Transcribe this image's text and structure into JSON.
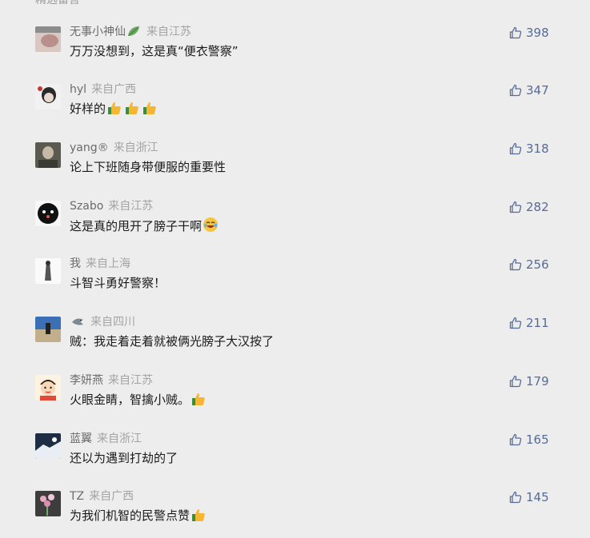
{
  "section": {
    "title": "精选留言"
  },
  "colors": {
    "like_icon": "#576b95",
    "text": "#1a1a1a",
    "meta": "#a4a4a4",
    "background": "#ededed"
  },
  "comments": [
    {
      "nickname": "无事小神仙",
      "location": "来自江苏",
      "text": "万万没想到，这是真“便衣警察”",
      "likes": "398",
      "nickname_emoji": "leaf-icon",
      "text_emoji": []
    },
    {
      "nickname": "hyl",
      "location": "来自广西",
      "text": "好样的",
      "likes": "347",
      "text_emoji": [
        "thumbs-up-icon",
        "thumbs-up-icon",
        "thumbs-up-icon"
      ]
    },
    {
      "nickname": "yang®",
      "location": "来自浙江",
      "text": "论上下班随身带便服的重要性",
      "likes": "318",
      "text_emoji": []
    },
    {
      "nickname": "Szabo",
      "location": "来自江苏",
      "text": "这是真的甩开了膀子干啊",
      "likes": "282",
      "text_emoji": [
        "laughing-tears-icon"
      ]
    },
    {
      "nickname": "我",
      "location": "来自上海",
      "text": "斗智斗勇好警察！",
      "likes": "256",
      "text_emoji": []
    },
    {
      "nickname": "",
      "location": "来自四川",
      "text": "贼：我走着走着就被俩光膀子大汉按了",
      "likes": "211",
      "nickname_emoji": "shark-icon",
      "text_emoji": []
    },
    {
      "nickname": "李妍燕",
      "location": "来自江苏",
      "text": "火眼金睛，智擒小贼。",
      "likes": "179",
      "text_emoji": [
        "thumbs-up-icon"
      ]
    },
    {
      "nickname": "蓝翼",
      "location": "来自浙江",
      "text": "还以为遇到打劫的了",
      "likes": "165",
      "text_emoji": []
    },
    {
      "nickname": "TZ",
      "location": "来自广西",
      "text": "为我们机智的民警点赞",
      "likes": "145",
      "text_emoji": [
        "thumbs-up-icon"
      ]
    }
  ]
}
